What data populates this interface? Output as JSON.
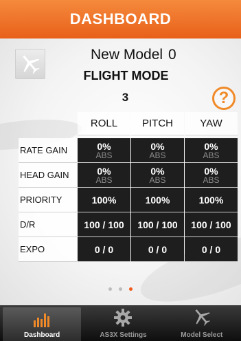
{
  "header": {
    "title": "DASHBOARD"
  },
  "model": {
    "name": "New Model",
    "number": "0"
  },
  "flight_mode": {
    "label": "FLIGHT MODE",
    "value": "3"
  },
  "help": {
    "glyph": "?"
  },
  "table": {
    "columns": [
      "ROLL",
      "PITCH",
      "YAW"
    ],
    "rows": [
      {
        "label": "RATE GAIN",
        "cells": [
          {
            "value": "0%",
            "sub": "ABS"
          },
          {
            "value": "0%",
            "sub": "ABS"
          },
          {
            "value": "0%",
            "sub": "ABS"
          }
        ]
      },
      {
        "label": "HEAD GAIN",
        "cells": [
          {
            "value": "0%",
            "sub": "ABS"
          },
          {
            "value": "0%",
            "sub": "ABS"
          },
          {
            "value": "0%",
            "sub": "ABS"
          }
        ]
      },
      {
        "label": "PRIORITY",
        "cells": [
          {
            "value": "100%"
          },
          {
            "value": "100%"
          },
          {
            "value": "100%"
          }
        ]
      },
      {
        "label": "D/R",
        "cells": [
          {
            "value": "100 / 100"
          },
          {
            "value": "100 / 100"
          },
          {
            "value": "100 / 100"
          }
        ]
      },
      {
        "label": "EXPO",
        "cells": [
          {
            "value": "0 / 0"
          },
          {
            "value": "0 / 0"
          },
          {
            "value": "0 / 0"
          }
        ]
      }
    ]
  },
  "pager": {
    "pages": 3,
    "current": 3
  },
  "tabbar": {
    "tabs": [
      {
        "label": "Dashboard",
        "icon": "bar-chart-icon",
        "active": true
      },
      {
        "label": "AS3X Settings",
        "icon": "gear-icon",
        "active": false
      },
      {
        "label": "Model Select",
        "icon": "airplane-icon",
        "active": false
      }
    ]
  },
  "colors": {
    "accent": "#ef5b1a",
    "cell_bg": "#1e1e1e",
    "help": "#f08a28"
  }
}
